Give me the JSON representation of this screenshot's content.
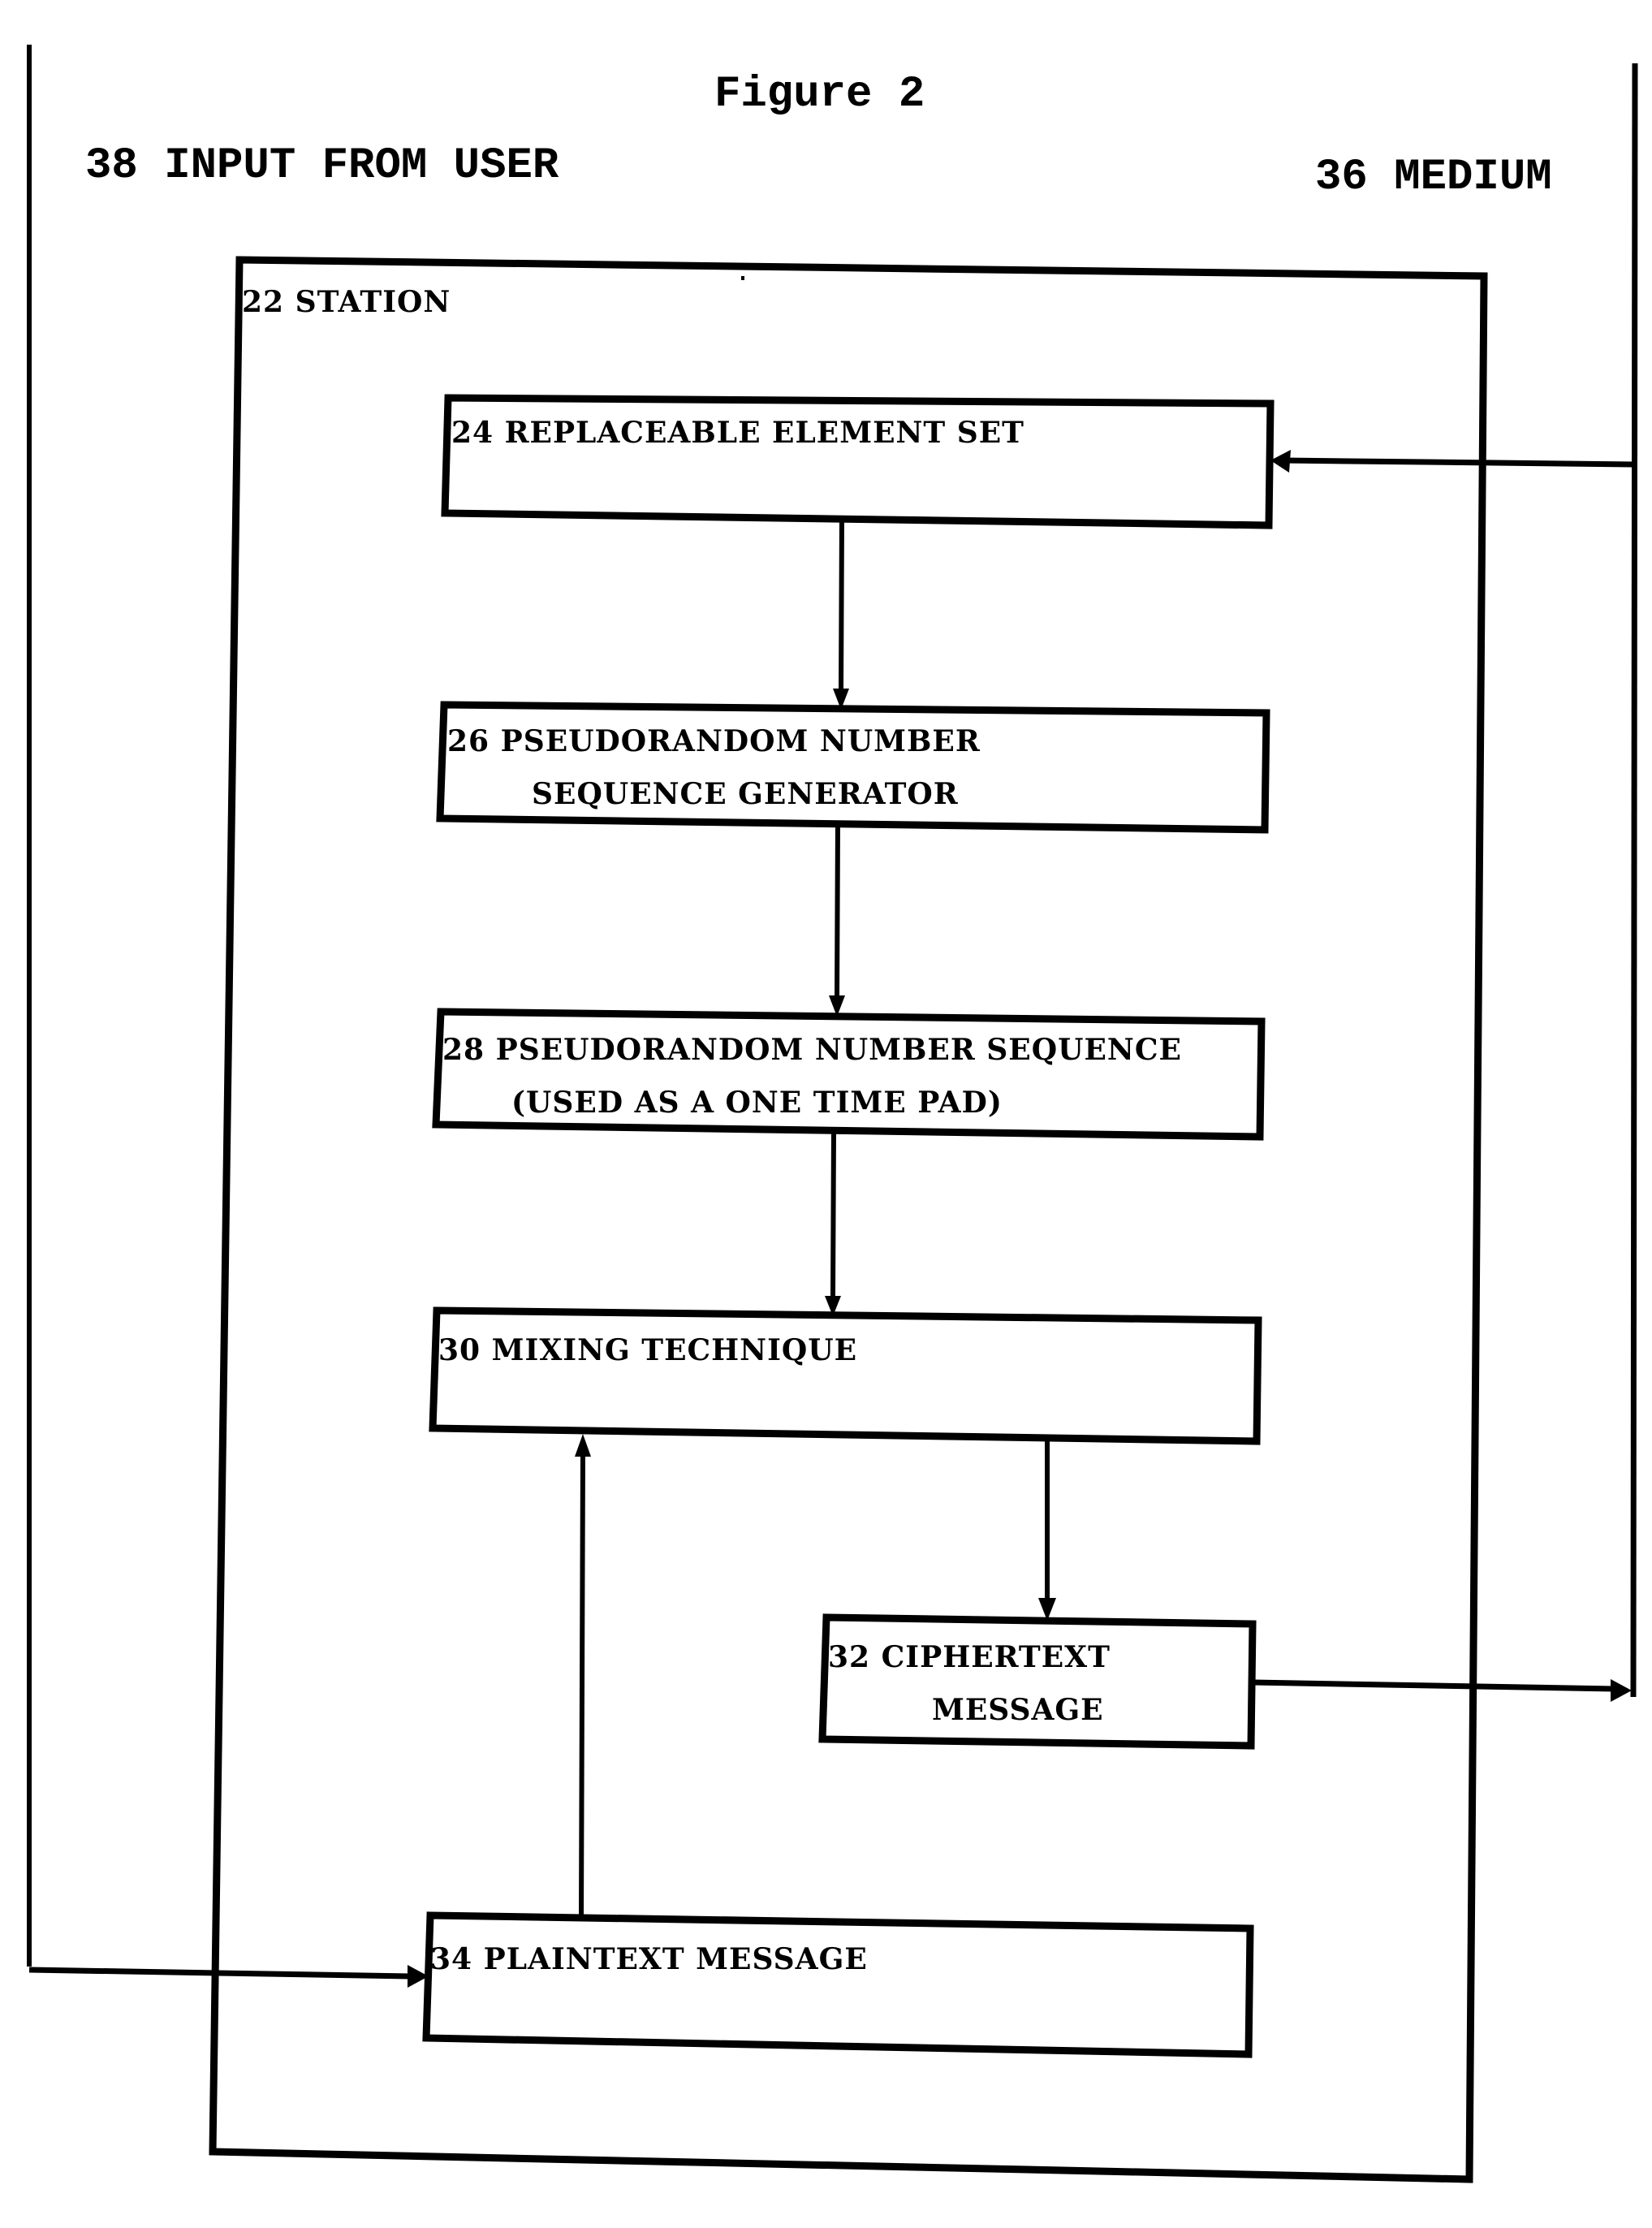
{
  "figure": {
    "title": "Figure 2",
    "input_label": "38 INPUT FROM USER",
    "medium_label": "36 MEDIUM",
    "station_label": "22 STATION",
    "ink_color": "#000000",
    "paper_color": "#ffffff"
  },
  "boxes": [
    {
      "id": "24",
      "lines": [
        "24 REPLACEABLE ELEMENT SET"
      ]
    },
    {
      "id": "26",
      "lines": [
        "26 PSEUDORANDOM NUMBER",
        "SEQUENCE GENERATOR"
      ]
    },
    {
      "id": "28",
      "lines": [
        "28 PSEUDORANDOM NUMBER SEQUENCE",
        "(USED AS A ONE TIME PAD)"
      ]
    },
    {
      "id": "30",
      "lines": [
        "30 MIXING TECHNIQUE"
      ]
    },
    {
      "id": "32",
      "lines": [
        "32 CIPHERTEXT",
        "MESSAGE"
      ]
    },
    {
      "id": "34",
      "lines": [
        "34 PLAINTEXT MESSAGE"
      ]
    }
  ],
  "connections": [
    {
      "from": "36",
      "to": "24"
    },
    {
      "from": "24",
      "to": "26"
    },
    {
      "from": "26",
      "to": "28"
    },
    {
      "from": "28",
      "to": "30"
    },
    {
      "from": "30",
      "to": "32"
    },
    {
      "from": "34",
      "to": "30"
    },
    {
      "from": "32",
      "to": "36"
    },
    {
      "from": "38",
      "to": "34"
    }
  ]
}
